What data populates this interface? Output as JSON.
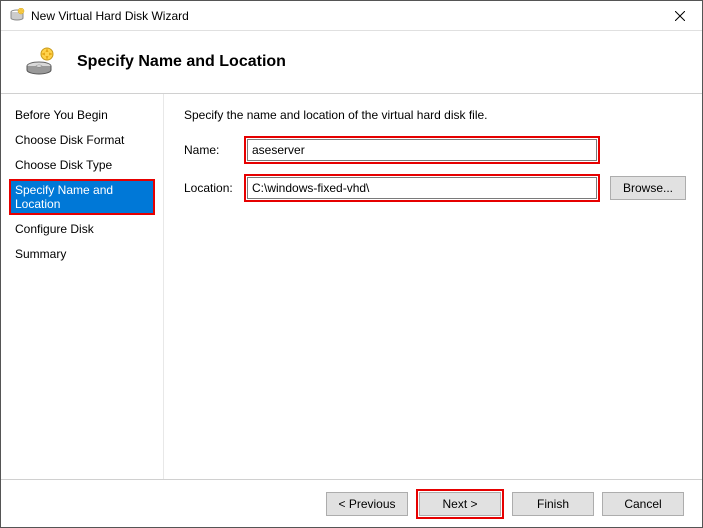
{
  "window": {
    "title": "New Virtual Hard Disk Wizard"
  },
  "header": {
    "title": "Specify Name and Location"
  },
  "sidebar": {
    "items": [
      {
        "label": "Before You Begin"
      },
      {
        "label": "Choose Disk Format"
      },
      {
        "label": "Choose Disk Type"
      },
      {
        "label": "Specify Name and Location",
        "active": true
      },
      {
        "label": "Configure Disk"
      },
      {
        "label": "Summary"
      }
    ]
  },
  "main": {
    "instruction": "Specify the name and location of the virtual hard disk file.",
    "name_label": "Name:",
    "name_value": "aseserver",
    "location_label": "Location:",
    "location_value": "C:\\windows-fixed-vhd\\",
    "browse_label": "Browse..."
  },
  "footer": {
    "previous": "< Previous",
    "next": "Next >",
    "finish": "Finish",
    "cancel": "Cancel"
  }
}
